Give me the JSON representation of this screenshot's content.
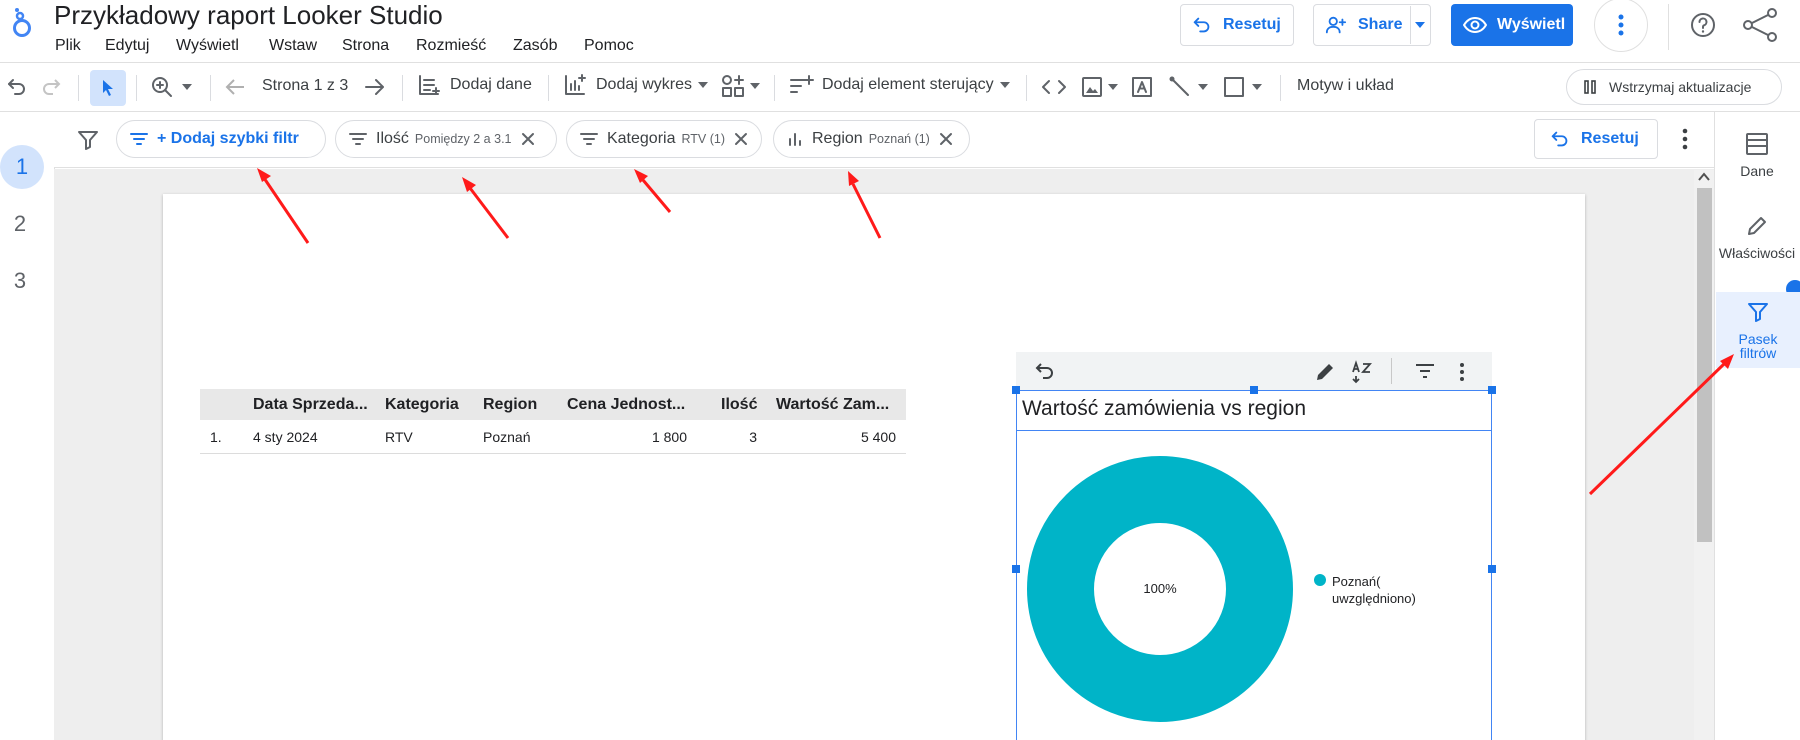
{
  "app": {
    "title": "Przykładowy raport Looker Studio",
    "menu": [
      "Plik",
      "Edytuj",
      "Wyświetl",
      "Wstaw",
      "Strona",
      "Rozmieść",
      "Zasób",
      "Pomoc"
    ]
  },
  "header_actions": {
    "reset_label": "Resetuj",
    "share_label": "Share",
    "view_label": "Wyświetl"
  },
  "toolbar": {
    "page_indicator": "Strona 1 z 3",
    "add_data": "Dodaj dane",
    "add_chart": "Dodaj wykres",
    "add_control": "Dodaj element sterujący",
    "theme_layout": "Motyw i układ",
    "pause_updates": "Wstrzymaj aktualizacje"
  },
  "filter_bar": {
    "add_quick_filter": "+ Dodaj szybki filtr",
    "chips": [
      {
        "label": "Ilość",
        "detail": "Pomiędzy 2 a 3.1"
      },
      {
        "label": "Kategoria",
        "detail": "RTV (1)"
      },
      {
        "label": "Region",
        "detail": "Poznań (1)"
      }
    ],
    "reset_label": "Resetuj"
  },
  "pages": [
    "1",
    "2",
    "3"
  ],
  "table": {
    "headers": [
      "Data Sprzeda...",
      "Kategoria",
      "Region",
      "Cena Jednost...",
      "Ilość",
      "Wartość Zam..."
    ],
    "rows": [
      {
        "index": "1.",
        "cells": [
          "4 sty 2024",
          "RTV",
          "Poznań",
          "1 800",
          "3",
          "5 400"
        ]
      }
    ]
  },
  "right_panel": {
    "data": "Dane",
    "properties": "Właściwości",
    "filter_bar": "Pasek filtrów"
  },
  "colors": {
    "accent": "#1a73e8",
    "donut": "#00b4c8",
    "annotation_arrow": "#ff1a1a"
  },
  "chart_data": {
    "type": "pie",
    "title": "Wartość zamówienia vs region",
    "donut": true,
    "categories": [
      "Poznań( uwzględniono)"
    ],
    "values": [
      100
    ],
    "data_labels": [
      "100%"
    ],
    "legend_position": "right"
  }
}
